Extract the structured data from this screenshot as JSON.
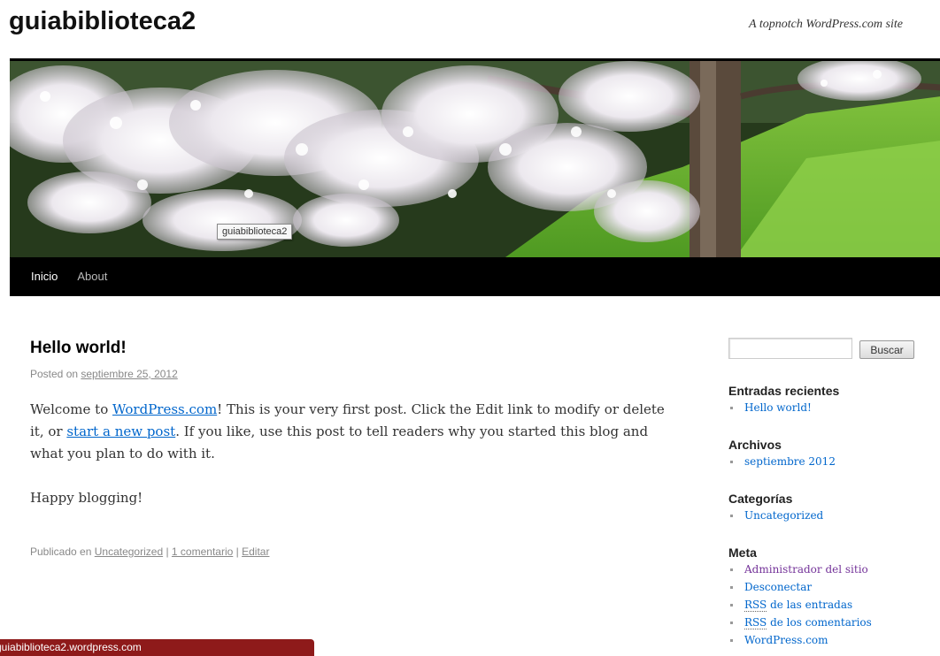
{
  "site": {
    "title": "guiabiblioteca2",
    "description": "A topnotch WordPress.com site",
    "header_image_tooltip": "guiabiblioteca2"
  },
  "nav": {
    "items": [
      {
        "label": "Inicio"
      },
      {
        "label": "About"
      }
    ]
  },
  "post": {
    "title": "Hello world!",
    "posted_on_prefix": "Posted on ",
    "date": "septiembre 25, 2012",
    "body": {
      "p1_part1": "Welcome to ",
      "p1_link1": "WordPress.com",
      "p1_part2": "! This is your very first post. Click the Edit link to modify or delete it, or ",
      "p1_link2": "start a new post",
      "p1_part3": ". If you like, use this post to tell readers why you started this blog and what you plan to do with it.",
      "p2": "Happy blogging!"
    },
    "footer": {
      "prefix": "Publicado en ",
      "category": "Uncategorized",
      "sep1": " | ",
      "comments": "1 comentario",
      "sep2": " | ",
      "edit": "Editar"
    }
  },
  "sidebar": {
    "search": {
      "placeholder": "",
      "button": "Buscar"
    },
    "recent": {
      "title": "Entradas recientes",
      "items": [
        "Hello world!"
      ]
    },
    "archives": {
      "title": "Archivos",
      "items": [
        "septiembre 2012"
      ]
    },
    "categories": {
      "title": "Categorías",
      "items": [
        "Uncategorized"
      ]
    },
    "meta": {
      "title": "Meta",
      "items": [
        {
          "label": "Administrador del sitio"
        },
        {
          "label": "Desconectar"
        },
        {
          "abbr": "RSS",
          "rest": " de las entradas"
        },
        {
          "abbr": "RSS",
          "rest": " de los comentarios"
        },
        {
          "label": "WordPress.com"
        }
      ]
    }
  },
  "status_bar": {
    "url": "guiabiblioteca2.wordpress.com"
  },
  "colors": {
    "link": "#0066cc",
    "visited_link": "#743399",
    "nav_background": "#000000",
    "status_bar": "#8e1a1a"
  }
}
